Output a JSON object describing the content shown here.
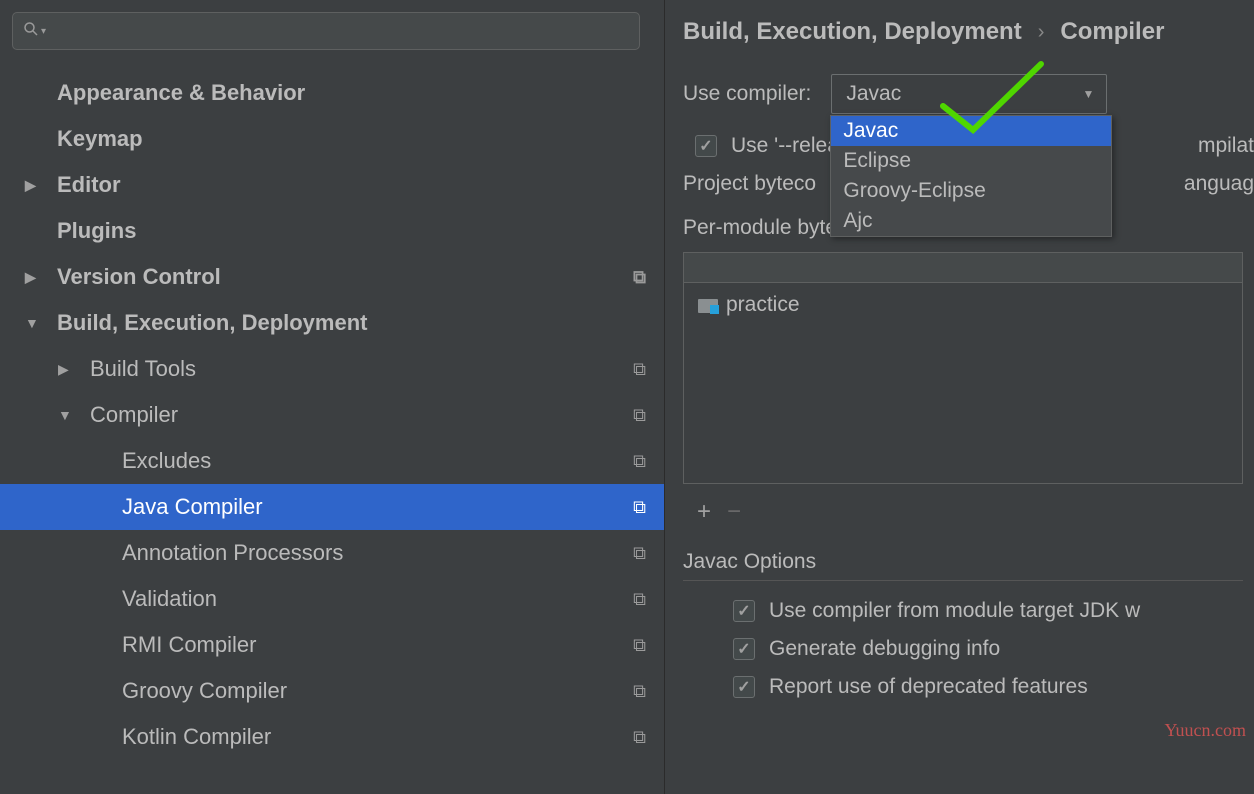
{
  "search": {
    "placeholder": ""
  },
  "sidebar": {
    "items": [
      {
        "label": "Appearance & Behavior",
        "level": 1,
        "bold": true,
        "expand": "none",
        "profile": false
      },
      {
        "label": "Keymap",
        "level": 1,
        "bold": true,
        "expand": "none",
        "profile": false
      },
      {
        "label": "Editor",
        "level": 1,
        "bold": true,
        "expand": "right",
        "profile": false
      },
      {
        "label": "Plugins",
        "level": 1,
        "bold": true,
        "expand": "none",
        "profile": false
      },
      {
        "label": "Version Control",
        "level": 1,
        "bold": true,
        "expand": "right",
        "profile": true
      },
      {
        "label": "Build, Execution, Deployment",
        "level": 1,
        "bold": true,
        "expand": "down",
        "profile": false
      },
      {
        "label": "Build Tools",
        "level": 2,
        "bold": false,
        "expand": "right",
        "profile": true
      },
      {
        "label": "Compiler",
        "level": 2,
        "bold": false,
        "expand": "down",
        "profile": true
      },
      {
        "label": "Excludes",
        "level": 3,
        "bold": false,
        "expand": "none",
        "profile": true
      },
      {
        "label": "Java Compiler",
        "level": 3,
        "bold": false,
        "expand": "none",
        "profile": true,
        "selected": true
      },
      {
        "label": "Annotation Processors",
        "level": 3,
        "bold": false,
        "expand": "none",
        "profile": true
      },
      {
        "label": "Validation",
        "level": 3,
        "bold": false,
        "expand": "none",
        "profile": true
      },
      {
        "label": "RMI Compiler",
        "level": 3,
        "bold": false,
        "expand": "none",
        "profile": true
      },
      {
        "label": "Groovy Compiler",
        "level": 3,
        "bold": false,
        "expand": "none",
        "profile": true
      },
      {
        "label": "Kotlin Compiler",
        "level": 3,
        "bold": false,
        "expand": "none",
        "profile": true
      }
    ]
  },
  "breadcrumb": [
    "Build, Execution, Deployment",
    "Compiler"
  ],
  "compiler": {
    "use_compiler_label": "Use compiler:",
    "selected": "Javac",
    "options": [
      "Javac",
      "Eclipse",
      "Groovy-Eclipse",
      "Ajc"
    ]
  },
  "release_checkbox": {
    "checked": true,
    "label_prefix": "Use '--relea",
    "label_suffix": "mpilat"
  },
  "project_bytecode": {
    "label": "Project byteco",
    "suffix": "anguag"
  },
  "per_module_label": "Per-module bytecode version:",
  "modules": [
    {
      "name": "practice"
    }
  ],
  "toolbar": {
    "add": "+",
    "remove": "−"
  },
  "javac_options": {
    "title": "Javac Options",
    "opts": [
      {
        "checked": true,
        "label": "Use compiler from module target JDK w"
      },
      {
        "checked": true,
        "label": "Generate debugging info"
      },
      {
        "checked": true,
        "label": "Report use of deprecated features"
      }
    ]
  },
  "watermark": "Yuucn.com"
}
